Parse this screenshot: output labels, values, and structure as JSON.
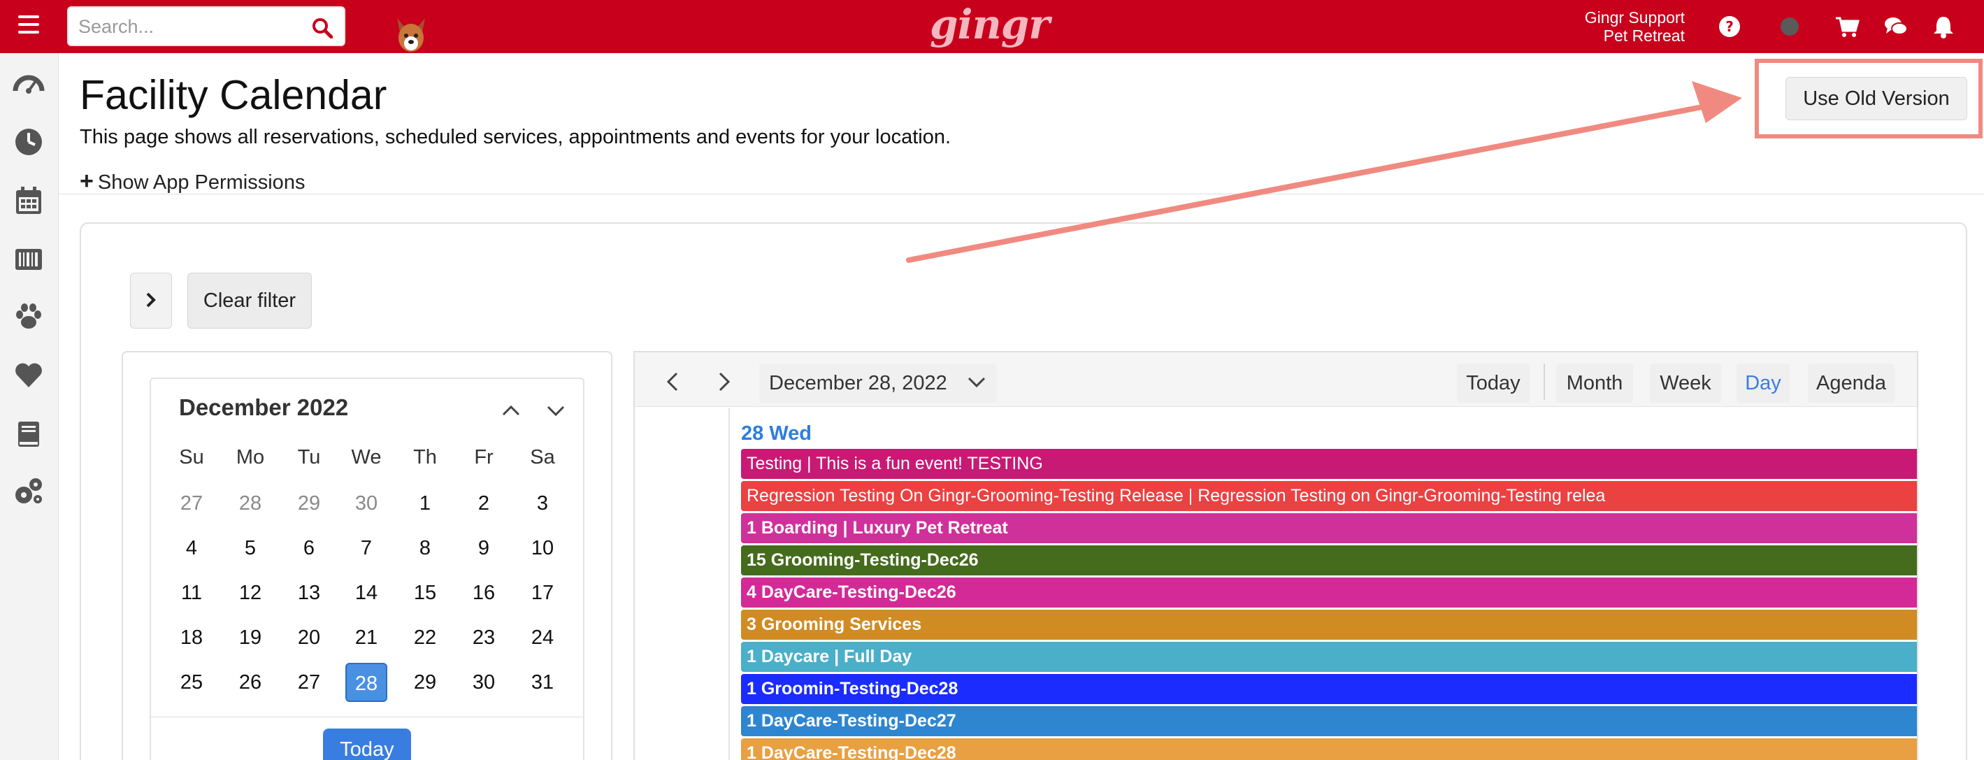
{
  "colors": {
    "brand_red": "#c8001c",
    "accent_blue": "#3a7de0",
    "annotation": "#f08a80"
  },
  "topbar": {
    "menu_icon": "hamburger-icon",
    "search_placeholder": "Search...",
    "search_icon": "search-icon",
    "mascot_icon": "dog-mascot-icon",
    "logo_text": "gingr",
    "user_name": "Gingr Support",
    "location_name": "Pet Retreat",
    "icons": [
      "help-icon",
      "status-dot-icon",
      "cart-icon",
      "chat-icon",
      "bell-icon"
    ]
  },
  "sidebar": {
    "icons": [
      "dashboard-icon",
      "clock-icon",
      "calendar-icon",
      "barcode-icon",
      "paw-icon",
      "heart-icon",
      "book-icon",
      "settings-icon"
    ]
  },
  "header": {
    "title": "Facility Calendar",
    "description": "This page shows all reservations, scheduled services, appointments and events for your location.",
    "permissions_label": "Show App Permissions",
    "old_version_label": "Use Old Version"
  },
  "filters": {
    "clear_label": "Clear filter"
  },
  "mini_calendar": {
    "month_label": "December 2022",
    "weekdays": [
      "Su",
      "Mo",
      "Tu",
      "We",
      "Th",
      "Fr",
      "Sa"
    ],
    "weeks": [
      [
        "27",
        "28",
        "29",
        "30",
        "1",
        "2",
        "3"
      ],
      [
        "4",
        "5",
        "6",
        "7",
        "8",
        "9",
        "10"
      ],
      [
        "11",
        "12",
        "13",
        "14",
        "15",
        "16",
        "17"
      ],
      [
        "18",
        "19",
        "20",
        "21",
        "22",
        "23",
        "24"
      ],
      [
        "25",
        "26",
        "27",
        "28",
        "29",
        "30",
        "31"
      ]
    ],
    "selected_day": "28",
    "today_label": "Today"
  },
  "day_view": {
    "date_label": "December 28, 2022",
    "toolbar": {
      "today": "Today",
      "month": "Month",
      "week": "Week",
      "day": "Day",
      "agenda": "Agenda",
      "active_view": "Day"
    },
    "day_header": "28 Wed",
    "events": [
      {
        "text": "Testing | This is a fun event! TESTING",
        "color": "#c81a74",
        "bold": false
      },
      {
        "text": "Regression Testing On Gingr-Grooming-Testing Release | Regression Testing on Gingr-Grooming-Testing relea",
        "color": "#eb4141",
        "bold": false
      },
      {
        "text": "1 Boarding | Luxury Pet Retreat",
        "color": "#d0309a",
        "bold": true
      },
      {
        "text": "15 Grooming-Testing-Dec26",
        "color": "#456b1d",
        "bold": true
      },
      {
        "text": "4 DayCare-Testing-Dec26",
        "color": "#d32a97",
        "bold": true
      },
      {
        "text": "3 Grooming Services",
        "color": "#d08b22",
        "bold": true
      },
      {
        "text": "1 Daycare | Full Day",
        "color": "#4aafc8",
        "bold": true
      },
      {
        "text": "1 Groomin-Testing-Dec28",
        "color": "#1a2cff",
        "bold": true
      },
      {
        "text": "1 DayCare-Testing-Dec27",
        "color": "#2f86d0",
        "bold": true
      },
      {
        "text": "1 DayCare-Testing-Dec28",
        "color": "#e8a042",
        "bold": true
      }
    ]
  }
}
